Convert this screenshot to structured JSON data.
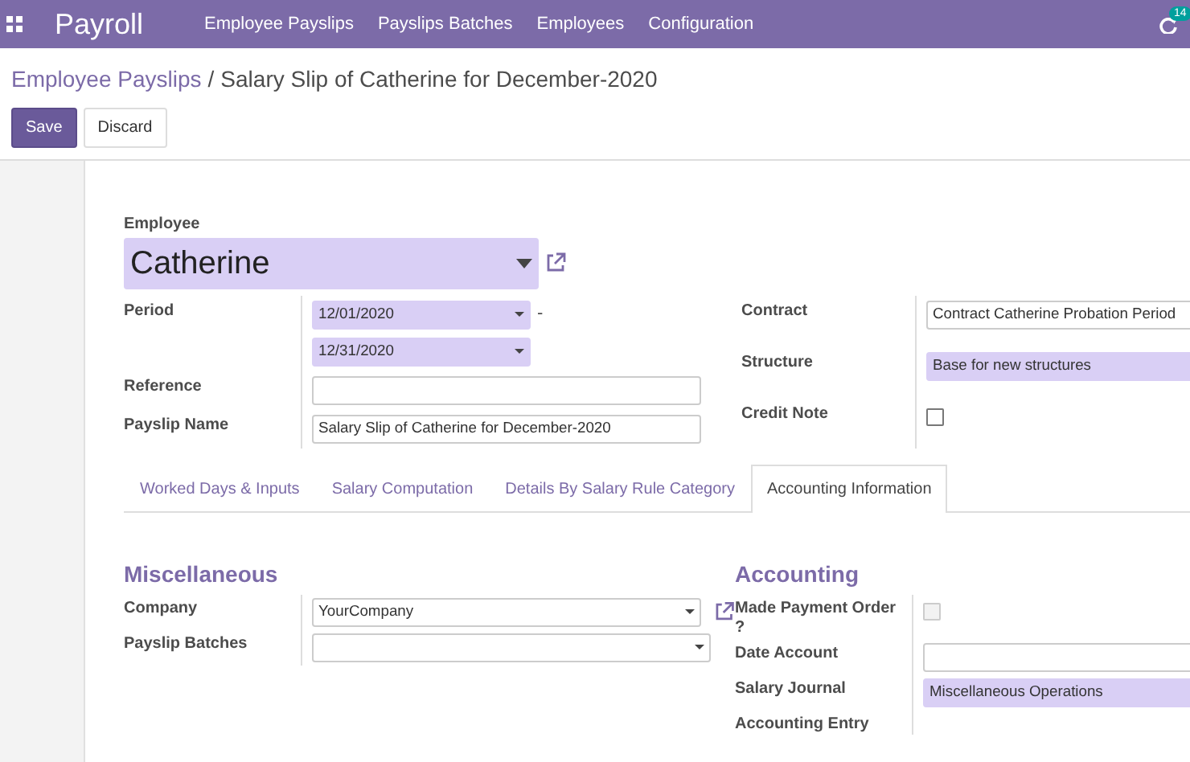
{
  "navbar": {
    "app_title": "Payroll",
    "menu": [
      "Employee Payslips",
      "Payslips Batches",
      "Employees",
      "Configuration"
    ],
    "badge": "14"
  },
  "breadcrumb": {
    "parent": "Employee Payslips",
    "separator": "/",
    "current": "Salary Slip of Catherine for December-2020"
  },
  "buttons": [
    {
      "label": "Save",
      "kind": "primary"
    },
    {
      "label": "Discard",
      "kind": "secondary"
    }
  ],
  "employee": {
    "label": "Employee",
    "value": "Catherine",
    "required": true
  },
  "left_fields": [
    {
      "label": "Period",
      "kind": "daterange",
      "values": [
        "12/01/2020",
        "12/31/2020"
      ],
      "separator": "-",
      "required": true
    },
    {
      "label": "Reference",
      "kind": "text"
    },
    {
      "label": "Payslip Name",
      "kind": "text",
      "value": "Salary Slip of Catherine for December-2020"
    }
  ],
  "right_fields": [
    {
      "label": "Contract",
      "kind": "text",
      "value": "Contract Catherine Probation Period"
    },
    {
      "label": "Structure",
      "kind": "text",
      "value": "Base for new structures",
      "required": true
    },
    {
      "label": "Credit Note",
      "kind": "checkbox",
      "checked": false
    }
  ],
  "tabs": [
    {
      "label": "Worked Days & Inputs",
      "selected": false
    },
    {
      "label": "Salary Computation",
      "selected": false
    },
    {
      "label": "Details By Salary Rule Category",
      "selected": false
    },
    {
      "label": "Accounting Information",
      "selected": true
    }
  ],
  "sections": [
    {
      "title": "Miscellaneous",
      "fields": [
        {
          "label": "Company",
          "kind": "select",
          "value": "YourCompany",
          "link": true
        },
        {
          "label": "Payslip Batches",
          "kind": "select"
        }
      ]
    },
    {
      "title": "Accounting",
      "fields": [
        {
          "label": "Made Payment Order ?",
          "kind": "checkbox",
          "checked": false,
          "disabled": true
        },
        {
          "label": "Date Account",
          "kind": "text"
        },
        {
          "label": "Salary Journal",
          "kind": "text",
          "value": "Miscellaneous Operations",
          "required": true
        },
        {
          "label": "Accounting Entry",
          "kind": "empty"
        }
      ]
    }
  ]
}
